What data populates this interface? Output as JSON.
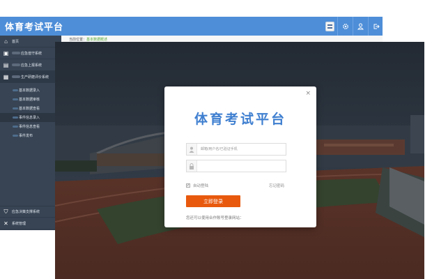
{
  "admin": {
    "brand": "体育考试平台",
    "top_icons": [
      "profile-icon",
      "gear-icon",
      "user-icon",
      "logout-icon"
    ],
    "breadcrumb": {
      "prefix": "当前位置：",
      "current": "基本数据概述"
    },
    "nav": {
      "home": "首页",
      "item1": "应急值守系统",
      "item2": "应急上报系统",
      "item3": "生产研磨评价系统",
      "sub": [
        "基本数据录入",
        "基本数据审核",
        "基本数据查看",
        "事件信息录入",
        "事件信息查看",
        "事件发布"
      ],
      "item4": "应急决策支撑系统",
      "item5": "系统管理"
    },
    "colors": {
      "topbar": "#4e8ed8",
      "sidebar": "#384454",
      "crumb_current": "#58a836"
    }
  },
  "login": {
    "close_glyph": "×",
    "title": "体育考试平台",
    "username_placeholder": "邮箱/用户名/已验证手机",
    "password_placeholder": "",
    "remember_label": "自动登陆",
    "forgot_label": "忘记密码",
    "submit_label": "立即登录",
    "alt_note": "您还可以使用合作账号登录网站：",
    "colors": {
      "title": "#3f7fd0",
      "button": "#e8590d"
    }
  }
}
